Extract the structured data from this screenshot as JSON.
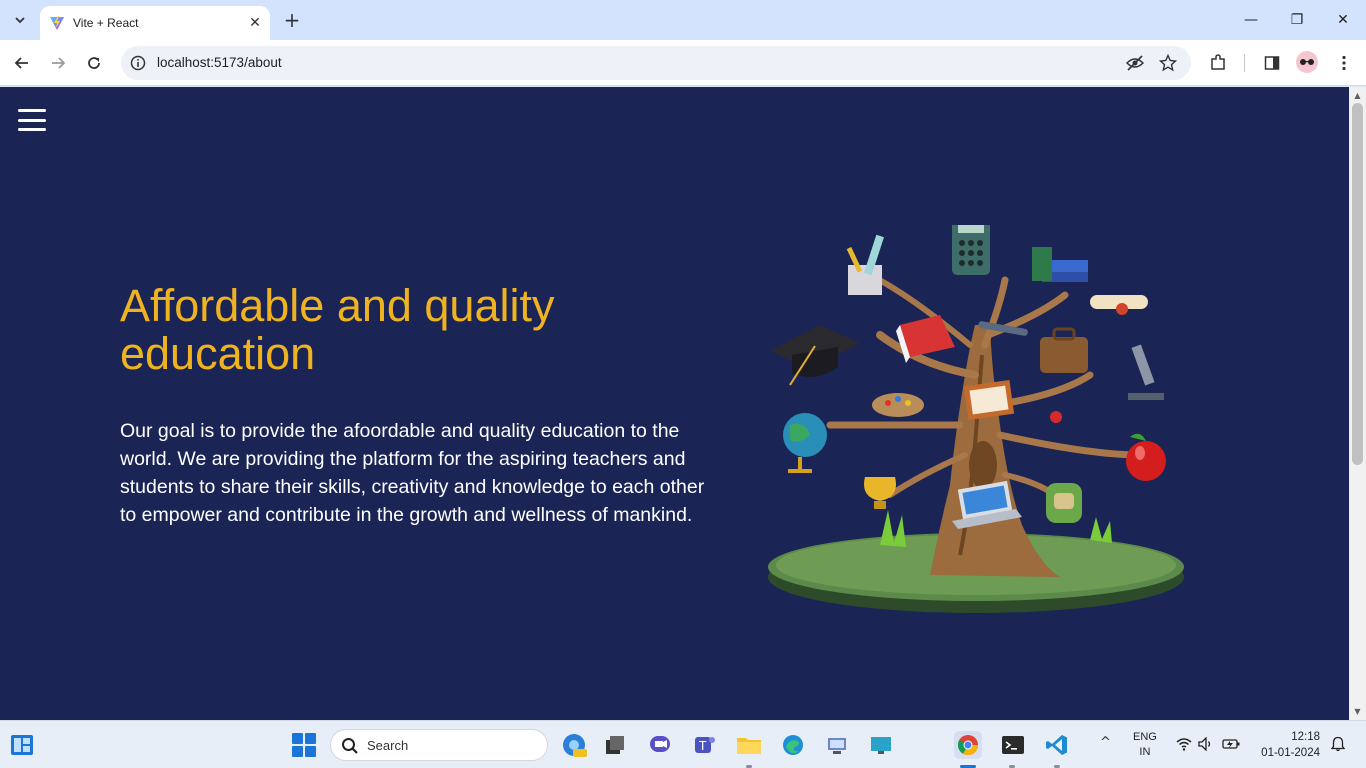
{
  "browser": {
    "tab_title": "Vite + React",
    "url": "localhost:5173/about",
    "new_tab_symbol": "+",
    "close_symbol": "✕"
  },
  "window_controls": {
    "minimize": "—",
    "maximize": "❐",
    "close": "✕"
  },
  "page": {
    "heading": "Affordable and quality education",
    "paragraph": "Our goal is to provide the afoordable and quality education to the world. We are providing the platform for the aspiring teachers and students to share their skills, creativity and knowledge to each other to empower and contribute in the growth and wellness of mankind.",
    "colors": {
      "background": "#1a2455",
      "heading": "#f0b320",
      "text": "#ffffff"
    }
  },
  "taskbar": {
    "search_label": "Search",
    "language_line1": "ENG",
    "language_line2": "IN",
    "time": "12:18",
    "date": "01-01-2024",
    "tray_chevron": "^"
  }
}
